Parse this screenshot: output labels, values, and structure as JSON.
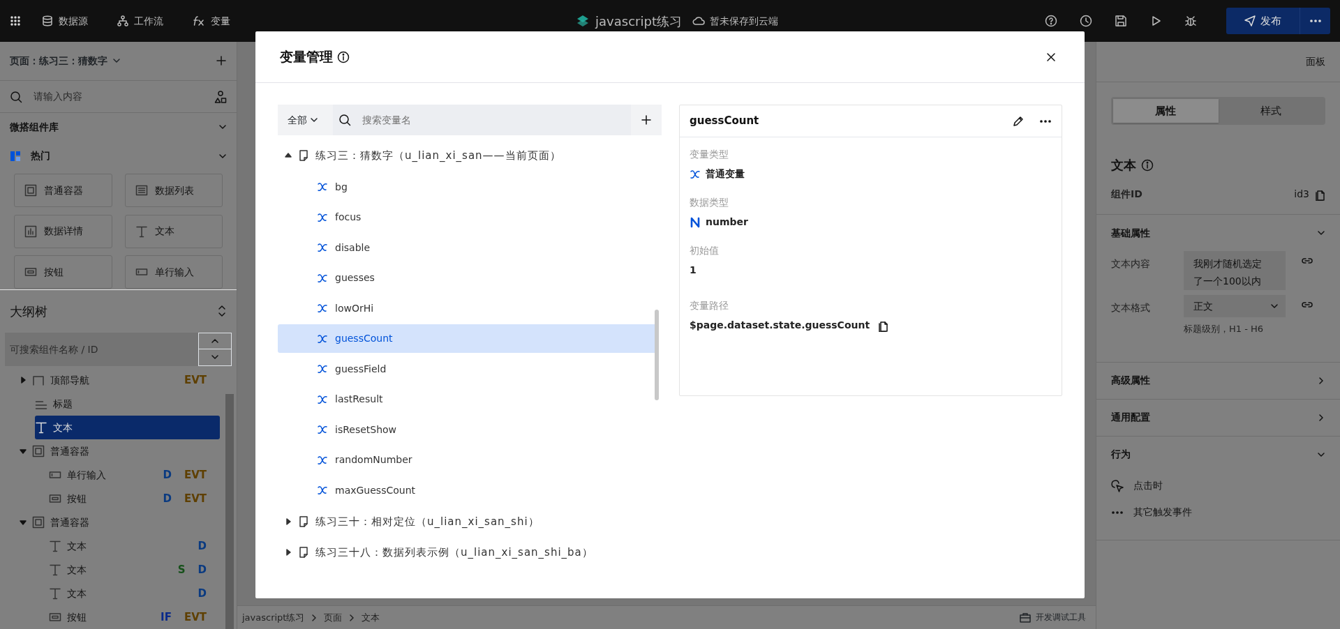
{
  "topbar": {
    "nav": [
      {
        "label": "数据源"
      },
      {
        "label": "工作流"
      },
      {
        "label": "变量"
      }
    ],
    "app_title": "javascript练习",
    "save_status": "暂未保存到云端",
    "publish": "发布"
  },
  "left_panel": {
    "page_selector": "页面：练习三：猜数字",
    "search": {
      "placeholder": "请输入内容"
    },
    "library": "微搭组件库",
    "category": "热门",
    "components": [
      {
        "label": "普通容器",
        "kind": "container"
      },
      {
        "label": "数据列表",
        "kind": "list"
      },
      {
        "label": "数据详情",
        "kind": "detail"
      },
      {
        "label": "文本",
        "kind": "text"
      },
      {
        "label": "按钮",
        "kind": "button"
      },
      {
        "label": "单行输入",
        "kind": "input"
      }
    ],
    "outline_title": "大纲树",
    "outline_search": {
      "placeholder": "可搜索组件名称 / ID"
    },
    "outline": [
      {
        "label": "顶部导航",
        "kind": "navbar",
        "expanded": false,
        "selected": false,
        "tags": [
          {
            "label": "EVT",
            "color": "#5e3f00"
          }
        ]
      },
      {
        "label": "标题",
        "kind": "heading",
        "selected": false
      },
      {
        "label": "文本",
        "kind": "text",
        "selected": true
      },
      {
        "label": "普通容器",
        "kind": "container",
        "expanded": true,
        "selected": false,
        "children": [
          {
            "label": "单行输入",
            "kind": "input",
            "selected": false,
            "tags": [
              {
                "label": "D",
                "color": "#0a3a80"
              },
              {
                "label": "EVT",
                "color": "#5e3f00"
              }
            ]
          },
          {
            "label": "按钮",
            "kind": "button",
            "selected": false,
            "tags": [
              {
                "label": "D",
                "color": "#0a3a80"
              },
              {
                "label": "EVT",
                "color": "#5e3f00"
              }
            ]
          }
        ]
      },
      {
        "label": "普通容器",
        "kind": "container",
        "expanded": true,
        "selected": false,
        "children": [
          {
            "label": "文本",
            "kind": "text",
            "selected": false,
            "tags": [
              {
                "label": "D",
                "color": "#0a3a80"
              }
            ]
          },
          {
            "label": "文本",
            "kind": "text",
            "selected": false,
            "tags": [
              {
                "label": "S",
                "color": "#16501a"
              },
              {
                "label": "D",
                "color": "#0a3a80"
              }
            ]
          },
          {
            "label": "文本",
            "kind": "text",
            "selected": false,
            "tags": [
              {
                "label": "D",
                "color": "#0a3a80"
              }
            ]
          },
          {
            "label": "按钮",
            "kind": "button",
            "selected": false,
            "tags": [
              {
                "label": "IF",
                "color": "#0a2a8a"
              },
              {
                "label": "EVT",
                "color": "#5e3f00"
              }
            ]
          }
        ]
      }
    ]
  },
  "right_panel": {
    "header": "面板",
    "tabs": [
      {
        "label": "属性",
        "selected": true
      },
      {
        "label": "样式",
        "selected": false
      }
    ],
    "component_title": "文本",
    "id_label": "组件ID",
    "id_value": "id3",
    "sections": [
      {
        "title": "基础属性",
        "expanded": true,
        "fields": [
          {
            "label": "文本内容",
            "kind": "textarea",
            "value": "我刚才随机选定了一个100以内"
          },
          {
            "label": "文本格式",
            "kind": "select",
            "value": "正文",
            "hint": "标题级别，H1 - H6"
          }
        ]
      },
      {
        "title": "高级属性",
        "expanded": false
      },
      {
        "title": "通用配置",
        "expanded": false
      },
      {
        "title": "行为",
        "expanded": true,
        "events": [
          {
            "label": "点击时",
            "kind": "click"
          },
          {
            "label": "其它触发事件",
            "kind": "more"
          }
        ]
      }
    ]
  },
  "breadcrumb": [
    "javascript练习",
    "页面",
    "文本"
  ],
  "debug_tools": "开发调试工具",
  "modal": {
    "title": "变量管理",
    "filter": "全部",
    "search": {
      "placeholder": "搜索变量名"
    },
    "groups": [
      {
        "label": "练习三：猜数字（u_lian_xi_san——当前页面）",
        "expanded": true,
        "variables": [
          {
            "name": "bg",
            "selected": false
          },
          {
            "name": "focus",
            "selected": false
          },
          {
            "name": "disable",
            "selected": false
          },
          {
            "name": "guesses",
            "selected": false
          },
          {
            "name": "lowOrHi",
            "selected": false
          },
          {
            "name": "guessCount",
            "selected": true
          },
          {
            "name": "guessField",
            "selected": false
          },
          {
            "name": "lastResult",
            "selected": false
          },
          {
            "name": "isResetShow",
            "selected": false
          },
          {
            "name": "randomNumber",
            "selected": false
          },
          {
            "name": "maxGuessCount",
            "selected": false
          }
        ]
      },
      {
        "label": "练习三十：相对定位（u_lian_xi_san_shi）",
        "expanded": false
      },
      {
        "label": "练习三十八：数据列表示例（u_lian_xi_san_shi_ba）",
        "expanded": false
      }
    ],
    "detail": {
      "name": "guessCount",
      "fields": [
        {
          "label": "变量类型",
          "value": "普通变量",
          "kind": "variable"
        },
        {
          "label": "数据类型",
          "value": "number",
          "kind": "number"
        },
        {
          "label": "初始值",
          "value": "1",
          "kind": "plain"
        },
        {
          "label": "变量路径",
          "value": "$page.dataset.state.guessCount",
          "kind": "path"
        }
      ]
    }
  }
}
